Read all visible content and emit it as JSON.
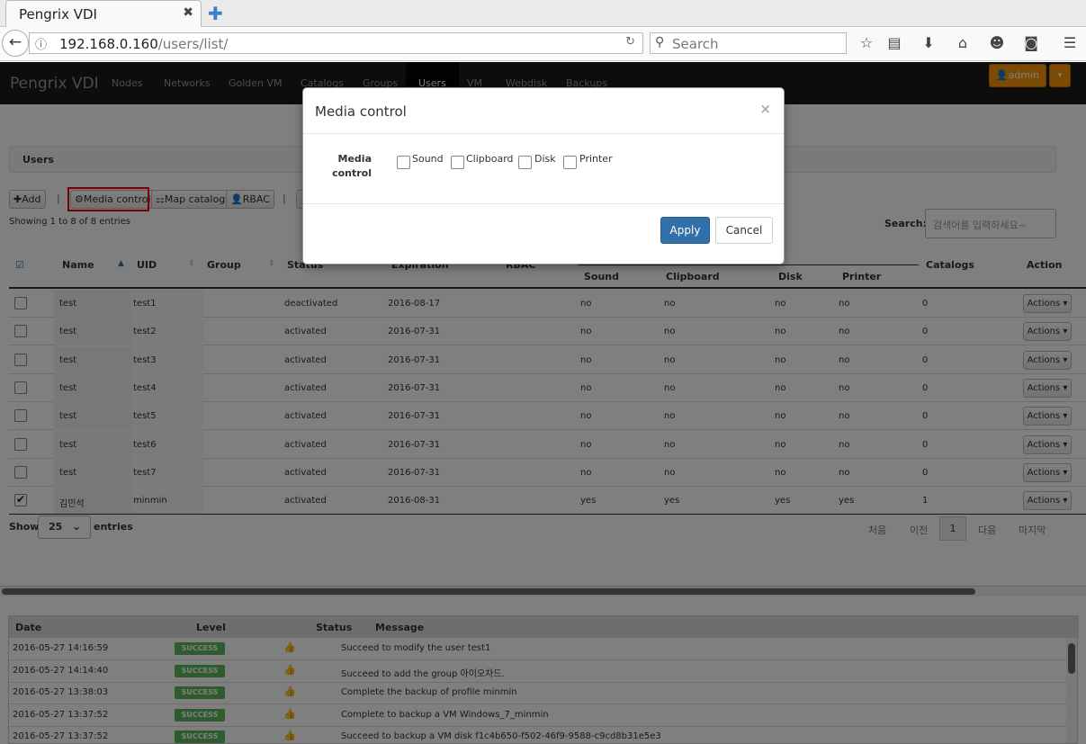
{
  "browser": {
    "tab_title": "Pengrix VDI",
    "url_host": "192.168.0.160",
    "url_path": "/users/list/",
    "search_placeholder": "Search"
  },
  "app": {
    "brand": "Pengrix VDI",
    "nav": [
      "Nodes",
      "Networks",
      "Golden VM",
      "Catalogs",
      "Groups",
      "Users",
      "VM",
      "Webdisk",
      "Backups"
    ],
    "active_nav": "Users",
    "user": "admin"
  },
  "page": {
    "title": "Users",
    "toolbar": {
      "add": "Add",
      "media_control": "Media control",
      "map_catalog": "Map catalog",
      "rbac": "RBAC"
    },
    "showing": "Showing 1 to 8 of 8 entries",
    "search_label": "Search:",
    "search_placeholder": "검색어를 입력하세요~",
    "columns": {
      "name": "Name",
      "uid": "UID",
      "group": "Group",
      "status": "Status",
      "expiration": "Expiration",
      "rbac": "RBAC",
      "sound": "Sound",
      "clipboard": "Clipboard",
      "disk": "Disk",
      "printer": "Printer",
      "catalogs": "Catalogs",
      "action": "Action"
    },
    "rows": [
      {
        "name": "test",
        "uid": "test1",
        "status": "deactivated",
        "expiration": "2016-08-17",
        "sound": "no",
        "clipboard": "no",
        "disk": "no",
        "printer": "no",
        "catalogs": "0",
        "checked": false
      },
      {
        "name": "test",
        "uid": "test2",
        "status": "activated",
        "expiration": "2016-07-31",
        "sound": "no",
        "clipboard": "no",
        "disk": "no",
        "printer": "no",
        "catalogs": "0",
        "checked": false
      },
      {
        "name": "test",
        "uid": "test3",
        "status": "activated",
        "expiration": "2016-07-31",
        "sound": "no",
        "clipboard": "no",
        "disk": "no",
        "printer": "no",
        "catalogs": "0",
        "checked": false
      },
      {
        "name": "test",
        "uid": "test4",
        "status": "activated",
        "expiration": "2016-07-31",
        "sound": "no",
        "clipboard": "no",
        "disk": "no",
        "printer": "no",
        "catalogs": "0",
        "checked": false
      },
      {
        "name": "test",
        "uid": "test5",
        "status": "activated",
        "expiration": "2016-07-31",
        "sound": "no",
        "clipboard": "no",
        "disk": "no",
        "printer": "no",
        "catalogs": "0",
        "checked": false
      },
      {
        "name": "test",
        "uid": "test6",
        "status": "activated",
        "expiration": "2016-07-31",
        "sound": "no",
        "clipboard": "no",
        "disk": "no",
        "printer": "no",
        "catalogs": "0",
        "checked": false
      },
      {
        "name": "test",
        "uid": "test7",
        "status": "activated",
        "expiration": "2016-07-31",
        "sound": "no",
        "clipboard": "no",
        "disk": "no",
        "printer": "no",
        "catalogs": "0",
        "checked": false
      },
      {
        "name": "김민석",
        "uid": "minmin",
        "status": "activated",
        "expiration": "2016-08-31",
        "sound": "yes",
        "clipboard": "yes",
        "disk": "yes",
        "printer": "yes",
        "catalogs": "1",
        "checked": true
      }
    ],
    "actions_label": "Actions",
    "show_label": "Show",
    "page_size": "25",
    "entries_label": "entries",
    "pager": {
      "first": "처음",
      "prev": "이전",
      "current": "1",
      "next": "다음",
      "last": "마지막"
    }
  },
  "log": {
    "headers": {
      "date": "Date",
      "level": "Level",
      "status": "Status",
      "message": "Message"
    },
    "rows": [
      {
        "date": "2016-05-27 14:16:59",
        "level": "SUCCESS",
        "message": "Succeed to modify the user test1"
      },
      {
        "date": "2016-05-27 14:14:40",
        "level": "SUCCESS",
        "message": "Succeed to add the group 아이오차드."
      },
      {
        "date": "2016-05-27 13:38:03",
        "level": "SUCCESS",
        "message": "Complete the backup of profile minmin"
      },
      {
        "date": "2016-05-27 13:37:52",
        "level": "SUCCESS",
        "message": "Complete to backup a VM Windows_7_minmin"
      },
      {
        "date": "2016-05-27 13:37:52",
        "level": "SUCCESS",
        "message": "Succeed to backup a VM disk f1c4b650-f502-46f9-9588-c9cd8b31e5e3"
      }
    ]
  },
  "modal": {
    "title": "Media control",
    "close": "×",
    "field_label_line1": "Media",
    "field_label_line2": "control",
    "options": [
      "Sound",
      "Clipboard",
      "Disk",
      "Printer"
    ],
    "apply": "Apply",
    "cancel": "Cancel"
  },
  "colors": {
    "accent": "#3071a9",
    "admin": "#f89406",
    "success": "#5cb85c",
    "highlight": "#ee0000"
  }
}
